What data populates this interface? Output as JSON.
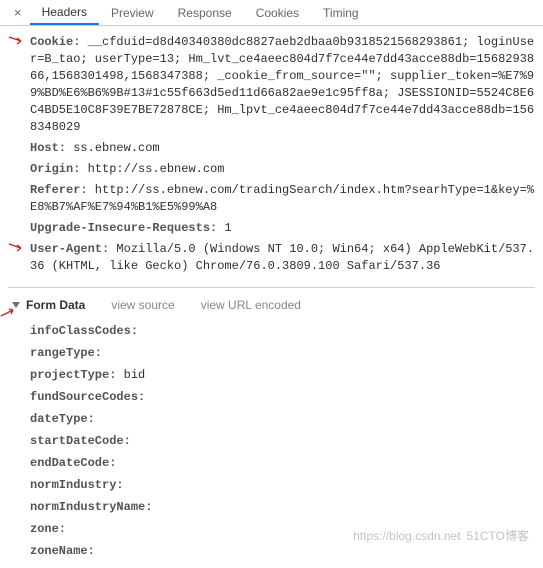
{
  "tabs": {
    "close": "×",
    "items": [
      "Headers",
      "Preview",
      "Response",
      "Cookies",
      "Timing"
    ],
    "activeIndex": 0
  },
  "headers": [
    {
      "key": "Cookie:",
      "value": " __cfduid=d8d40340380dc8827aeb2dbaa0b9318521568293861; loginUser=B_tao; userType=13; Hm_lvt_ce4aeec804d7f7ce44e7dd43acce88db=1568293866,1568301498,1568347388; _cookie_from_source=\"\"; supplier_token=%E7%99%BD%E6%B6%9B#13#1c55f663d5ed11d66a82ae9e1c95ff8a; JSESSIONID=5524C8E6C4BD5E10C8F39E7BE72878CE; Hm_lpvt_ce4aeec804d7f7ce44e7dd43acce88db=1568348029",
      "arrow": true
    },
    {
      "key": "Host:",
      "value": " ss.ebnew.com"
    },
    {
      "key": "Origin:",
      "value": " http://ss.ebnew.com"
    },
    {
      "key": "Referer:",
      "value": " http://ss.ebnew.com/tradingSearch/index.htm?searhType=1&key=%E8%B7%AF%E7%94%B1%E5%99%A8"
    },
    {
      "key": "Upgrade-Insecure-Requests:",
      "value": " 1"
    },
    {
      "key": "User-Agent:",
      "value": " Mozilla/5.0 (Windows NT 10.0; Win64; x64) AppleWebKit/537.36 (KHTML, like Gecko) Chrome/76.0.3809.100 Safari/537.36",
      "arrow": true
    }
  ],
  "section": {
    "title": "Form Data",
    "link1": "view source",
    "link2": "view URL encoded"
  },
  "form": [
    {
      "key": "infoClassCodes:",
      "value": ""
    },
    {
      "key": "rangeType:",
      "value": ""
    },
    {
      "key": "projectType:",
      "value": " bid"
    },
    {
      "key": "fundSourceCodes:",
      "value": ""
    },
    {
      "key": "dateType:",
      "value": ""
    },
    {
      "key": "startDateCode:",
      "value": ""
    },
    {
      "key": "endDateCode:",
      "value": ""
    },
    {
      "key": "normIndustry:",
      "value": ""
    },
    {
      "key": "normIndustryName:",
      "value": ""
    },
    {
      "key": "zone:",
      "value": ""
    },
    {
      "key": "zoneName:",
      "value": ""
    }
  ],
  "watermark_left": "https://blog.csdn.net",
  "watermark_right": "51CTO博客",
  "icons": {
    "arrow_color": "#d11f1f"
  }
}
